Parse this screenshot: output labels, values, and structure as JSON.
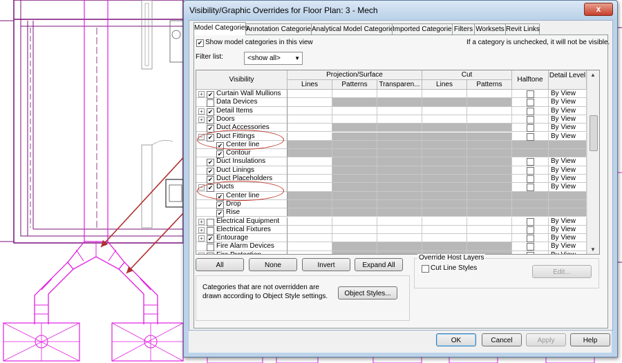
{
  "dialog": {
    "title": "Visibility/Graphic Overrides for Floor Plan: 3 - Mech",
    "close_glyph": "x",
    "tabs": [
      "Model Categories",
      "Annotation Categories",
      "Analytical Model Categories",
      "Imported Categories",
      "Filters",
      "Worksets",
      "Revit Links"
    ],
    "show_model_categories": {
      "label": "Show model categories in this view",
      "checked": true
    },
    "unchecked_note": "If a category is unchecked, it will not be visible.",
    "filter_list": {
      "label": "Filter list:",
      "value": "<show all>"
    },
    "table": {
      "headers": {
        "visibility": "Visibility",
        "projection": "Projection/Surface",
        "cut": "Cut",
        "halftone": "Halftone",
        "detail_level": "Detail Level",
        "lines": "Lines",
        "patterns": "Patterns",
        "transparency": "Transparen..."
      },
      "rows": [
        {
          "name": "Curtain Wall Mullions",
          "indent": 0,
          "expander": "+",
          "checked": true,
          "gray": false,
          "halftone": true,
          "detail": "By View"
        },
        {
          "name": "Data Devices",
          "indent": 0,
          "expander": "",
          "checked": false,
          "gray": true,
          "halftone": true,
          "detail": "By View"
        },
        {
          "name": "Detail Items",
          "indent": 0,
          "expander": "+",
          "checked": true,
          "gray": false,
          "halftone": true,
          "detail": "By View"
        },
        {
          "name": "Doors",
          "indent": 0,
          "expander": "+",
          "checked": true,
          "gray": false,
          "halftone": true,
          "detail": "By View"
        },
        {
          "name": "Duct Accessories",
          "indent": 0,
          "expander": "",
          "checked": true,
          "gray": true,
          "halftone": true,
          "detail": "By View"
        },
        {
          "name": "Duct Fittings",
          "indent": 0,
          "expander": "−",
          "checked": true,
          "gray": true,
          "halftone": true,
          "detail": "By View"
        },
        {
          "name": "Center line",
          "indent": 1,
          "expander": "",
          "checked": true,
          "gray": true,
          "halftone": false,
          "detail": ""
        },
        {
          "name": "Contour",
          "indent": 1,
          "expander": "",
          "checked": true,
          "gray": true,
          "halftone": false,
          "detail": ""
        },
        {
          "name": "Duct Insulations",
          "indent": 0,
          "expander": "",
          "checked": true,
          "gray": true,
          "halftone": true,
          "detail": "By View"
        },
        {
          "name": "Duct Linings",
          "indent": 0,
          "expander": "",
          "checked": true,
          "gray": true,
          "halftone": true,
          "detail": "By View"
        },
        {
          "name": "Duct Placeholders",
          "indent": 0,
          "expander": "",
          "checked": true,
          "gray": true,
          "halftone": true,
          "detail": "By View"
        },
        {
          "name": "Ducts",
          "indent": 0,
          "expander": "−",
          "checked": true,
          "gray": true,
          "halftone": true,
          "detail": "By View"
        },
        {
          "name": "Center line",
          "indent": 1,
          "expander": "",
          "checked": true,
          "gray": true,
          "halftone": false,
          "detail": ""
        },
        {
          "name": "Drop",
          "indent": 1,
          "expander": "",
          "checked": true,
          "gray": true,
          "halftone": false,
          "detail": ""
        },
        {
          "name": "Rise",
          "indent": 1,
          "expander": "",
          "checked": true,
          "gray": true,
          "halftone": false,
          "detail": ""
        },
        {
          "name": "Electrical Equipment",
          "indent": 0,
          "expander": "+",
          "checked": false,
          "gray": false,
          "halftone": true,
          "detail": "By View"
        },
        {
          "name": "Electrical Fixtures",
          "indent": 0,
          "expander": "+",
          "checked": false,
          "gray": false,
          "halftone": true,
          "detail": "By View"
        },
        {
          "name": "Entourage",
          "indent": 0,
          "expander": "+",
          "checked": true,
          "gray": false,
          "halftone": true,
          "detail": "By View"
        },
        {
          "name": "Fire Alarm Devices",
          "indent": 0,
          "expander": "",
          "checked": false,
          "gray": true,
          "halftone": true,
          "detail": "By View"
        },
        {
          "name": "Fire Protection",
          "indent": 0,
          "expander": "+",
          "checked": false,
          "gray": true,
          "halftone": true,
          "detail": "By View"
        }
      ]
    },
    "buttons": {
      "all": "All",
      "none": "None",
      "invert": "Invert",
      "expand_all": "Expand All"
    },
    "override_host_layers": {
      "title": "Override Host Layers",
      "cut_line_styles": "Cut Line Styles",
      "edit": "Edit..."
    },
    "note": "Categories that are not overridden are drawn according to Object Style settings.",
    "object_styles": "Object Styles...",
    "footer": {
      "ok": "OK",
      "cancel": "Cancel",
      "apply": "Apply",
      "help": "Help"
    }
  },
  "colors": {
    "cad_magenta": "#e01ee0",
    "cad_purple": "#7a0f7a",
    "annotation_red": "#b03030",
    "grid_gray": "#b8b8b8"
  }
}
